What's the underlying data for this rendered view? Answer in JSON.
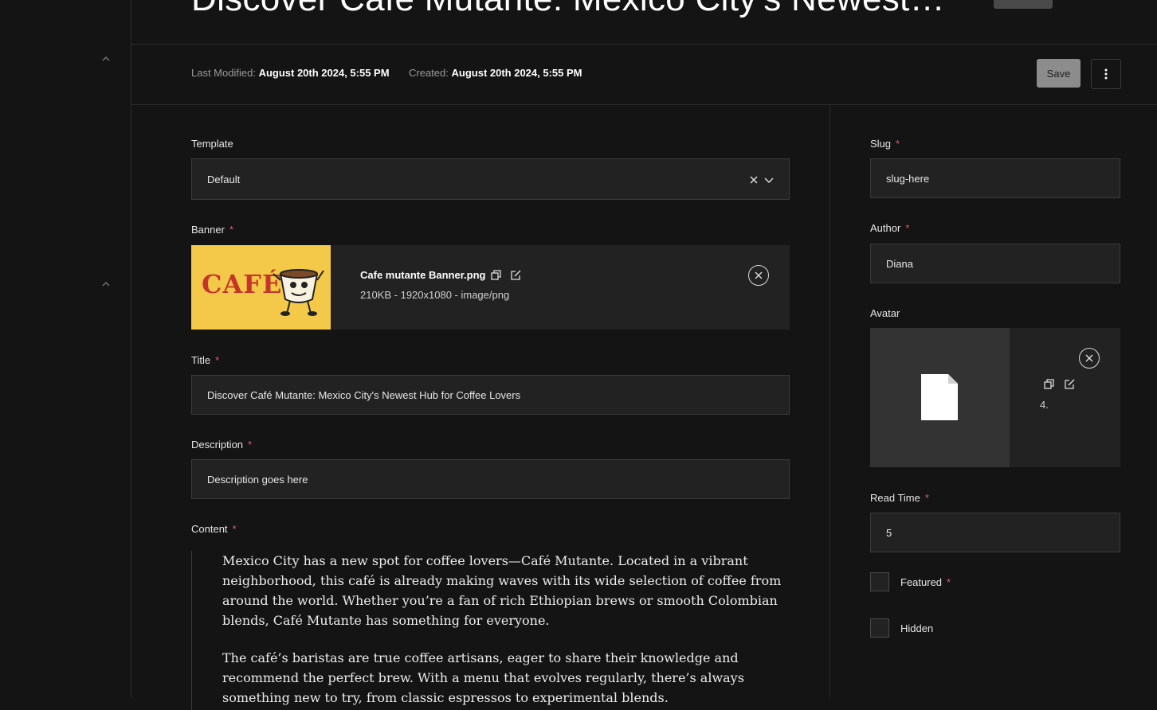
{
  "header": {
    "title": "Discover Café Mutante: Mexico City's Newest…"
  },
  "meta": {
    "last_modified_label": "Last Modified:",
    "last_modified_value": "August 20th 2024, 5:55 PM",
    "created_label": "Created:",
    "created_value": "August 20th 2024, 5:55 PM",
    "save_label": "Save"
  },
  "form": {
    "template": {
      "label": "Template",
      "value": "Default"
    },
    "banner": {
      "label": "Banner",
      "filename": "Cafe mutante Banner.png",
      "info": "210KB - 1920x1080 - image/png",
      "logo_text": "CAFÉ",
      "logo_colors": {
        "background": "#f4c94a",
        "text": "#c5362a"
      }
    },
    "title": {
      "label": "Title",
      "value": "Discover Café Mutante: Mexico City's Newest Hub for Coffee Lovers"
    },
    "description": {
      "label": "Description",
      "placeholder": "Description goes here"
    },
    "content": {
      "label": "Content",
      "paragraphs": [
        "Mexico City has a new spot for coffee lovers—Café Mutante. Located in a vibrant neighborhood, this café is already making waves with its wide selection of coffee from around the world. Whether you’re a fan of rich Ethiopian brews or smooth Colombian blends, Café Mutante has something for everyone.",
        "The café’s baristas are true coffee artisans, eager to share their knowledge and recommend the perfect brew. With a menu that evolves regularly, there’s always something new to try, from classic espressos to experimental blends."
      ]
    },
    "slug": {
      "label": "Slug",
      "value": "slug-here"
    },
    "author": {
      "label": "Author",
      "value": "Diana"
    },
    "avatar": {
      "label": "Avatar",
      "info_truncated": "4."
    },
    "read_time": {
      "label": "Read Time",
      "value": "5"
    },
    "featured": {
      "label": "Featured",
      "checked": false
    },
    "hidden": {
      "label": "Hidden",
      "checked": false
    },
    "required_marker": "*"
  },
  "colors": {
    "background": "#141414",
    "field_bg": "#222222",
    "required": "#e0596b",
    "save_button": "#8c8c8c"
  }
}
